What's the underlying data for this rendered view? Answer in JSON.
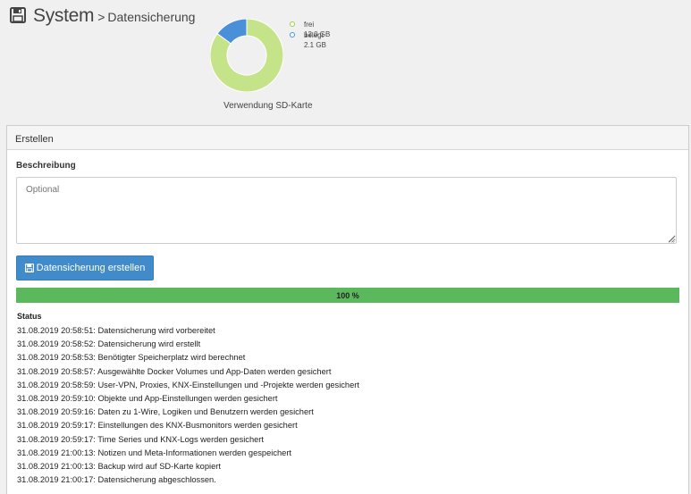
{
  "header": {
    "title": "System",
    "separator": ">",
    "subtitle": "Datensicherung"
  },
  "chart_data": {
    "type": "pie",
    "donut": true,
    "categories": [
      "frei",
      "belegt"
    ],
    "values": [
      12.0,
      2.1
    ],
    "value_labels": [
      "12.0 GB",
      "2.1 GB"
    ],
    "colors": [
      "#c5e48a",
      "#4a90d9"
    ],
    "caption": "Verwendung SD-Karte",
    "legend_placement": "right"
  },
  "panel": {
    "heading": "Erstellen",
    "description_label": "Beschreibung",
    "description_placeholder": "Optional",
    "description_value": "",
    "create_button_label": "Datensicherung erstellen",
    "progress_percent": 100,
    "progress_label": "100 %",
    "status_label": "Status",
    "log": [
      "31.08.2019 20:58:51: Datensicherung wird vorbereitet",
      "31.08.2019 20:58:52: Datensicherung wird erstellt",
      "31.08.2019 20:58:53: Benötigter Speicherplatz wird berechnet",
      "31.08.2019 20:58:57: Ausgewählte Docker Volumes und App-Daten werden gesichert",
      "31.08.2019 20:58:59: User-VPN, Proxies, KNX-Einstellungen und -Projekte werden gesichert",
      "31.08.2019 20:59:10: Objekte und App-Einstellungen werden gesichert",
      "31.08.2019 20:59:16: Daten zu 1-Wire, Logiken und Benutzern werden gesichert",
      "31.08.2019 20:59:17: Einstellungen des KNX-Busmonitors werden gesichert",
      "31.08.2019 20:59:17: Time Series und KNX-Logs werden gesichert",
      "31.08.2019 21:00:13: Notizen und Meta-Informationen werden gespeichert",
      "31.08.2019 21:00:13: Backup wird auf SD-Karte kopiert",
      "31.08.2019 21:00:17: Datensicherung abgeschlossen."
    ]
  }
}
